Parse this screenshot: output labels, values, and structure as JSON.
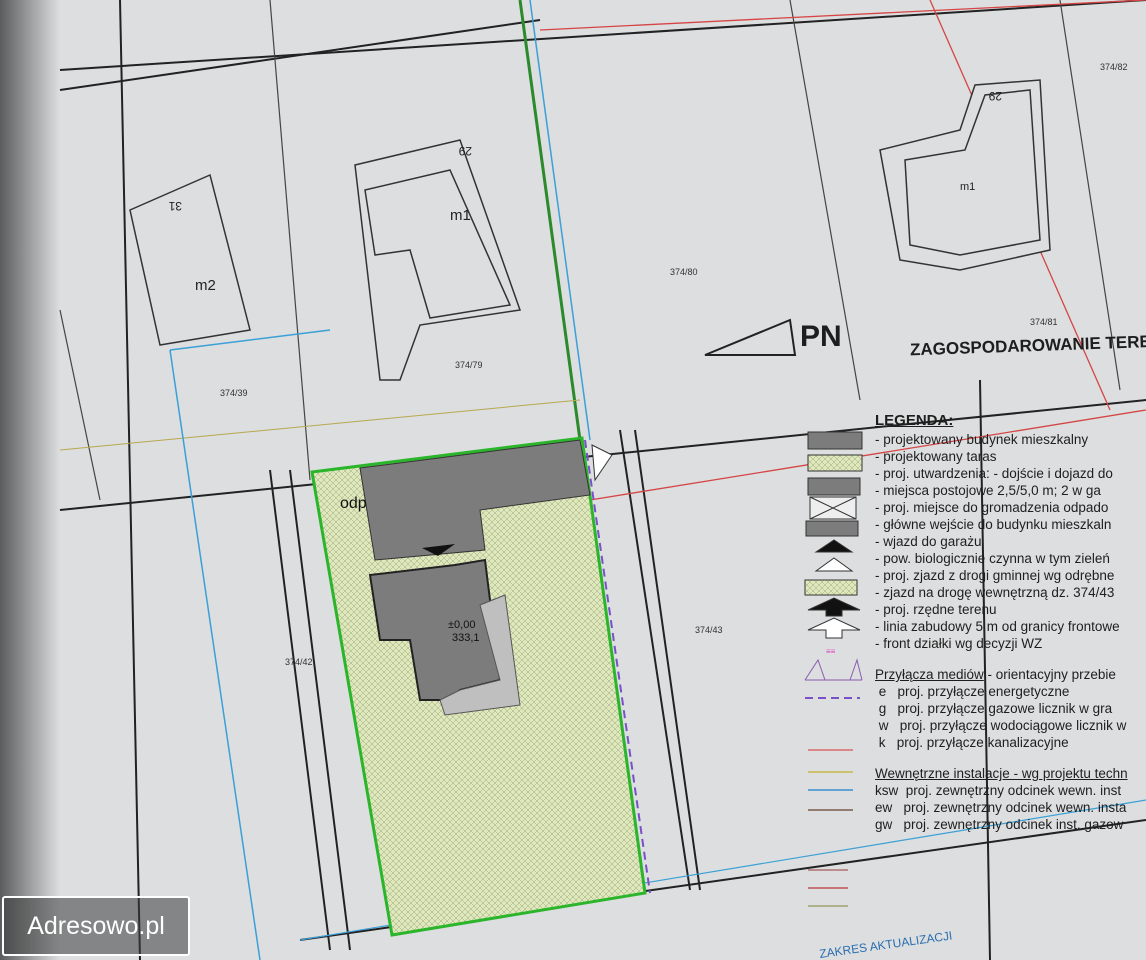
{
  "plan": {
    "title": "ZAGOSPODAROWANIE TEREN",
    "north_label": "PN",
    "buildings": [
      "m1",
      "m2",
      "m1"
    ],
    "house_numbers": [
      "31",
      "29",
      "29"
    ],
    "waste_label": "odp",
    "level_zero": "±0,00",
    "level_value": "333,1",
    "parcels": [
      "374/80",
      "374/42",
      "374/43",
      "374/82",
      "374/81",
      "374/39",
      "374/79"
    ],
    "update_scope": "ZAKRES AKTUALIZACJI"
  },
  "legend": {
    "heading": "LEGENDA:",
    "items": [
      "- projektowany budynek mieszkalny",
      "- projektowany taras",
      "- proj. utwardzenia: - dojście i dojazd do",
      "- miejsca postojowe 2,5/5,0 m; 2 w ga",
      "- proj. miejsce do gromadzenia odpado",
      "- główne wejście do budynku mieszkaln",
      "- wjazd do garażu",
      "- pow. biologicznie czynna w tym zieleń",
      "- proj. zjazd z drogi gminnej wg odrębne",
      "- zjazd na drogę wewnętrzną dz. 374/43",
      "- proj. rzędne terenu",
      "- linia zabudowy 5 m od granicy frontowe",
      "- front działki wg decyzji WZ"
    ],
    "utilities_heading": "Przyłącza mediów",
    "utilities_suffix": " - orientacyjny przebie",
    "utilities": [
      {
        "code": "e",
        "text": "proj. przyłącze energetyczne",
        "color": "#d96a6a"
      },
      {
        "code": "g",
        "text": "proj. przyłącze gazowe licznik w gra",
        "color": "#c9b84a"
      },
      {
        "code": "w",
        "text": "proj. przyłącze wodociągowe licznik w",
        "color": "#3a8fd0"
      },
      {
        "code": "k",
        "text": "proj. przyłącze kanalizacyjne",
        "color": "#7a5a4a"
      }
    ],
    "internal_heading": "Wewnętrzne instalacje - wg projektu techn",
    "internal": [
      {
        "code": "ksw",
        "text": "proj. zewnętrzny odcinek wewn. inst",
        "color": "#b07070"
      },
      {
        "code": "ew",
        "text": "proj. zewnętrzny odcinek wewn. insta",
        "color": "#c05050"
      },
      {
        "code": "gw",
        "text": "proj. zewnętrzny odcinek inst. gazow",
        "color": "#a0a070"
      }
    ]
  },
  "watermark": "Adresowo.pl",
  "colors": {
    "plot_border": "#2bb52b",
    "plot_fill": "#dfe8b8",
    "building": "#7c7c7c",
    "boundary_red": "#d64545",
    "water_blue": "#3aa0d8"
  }
}
